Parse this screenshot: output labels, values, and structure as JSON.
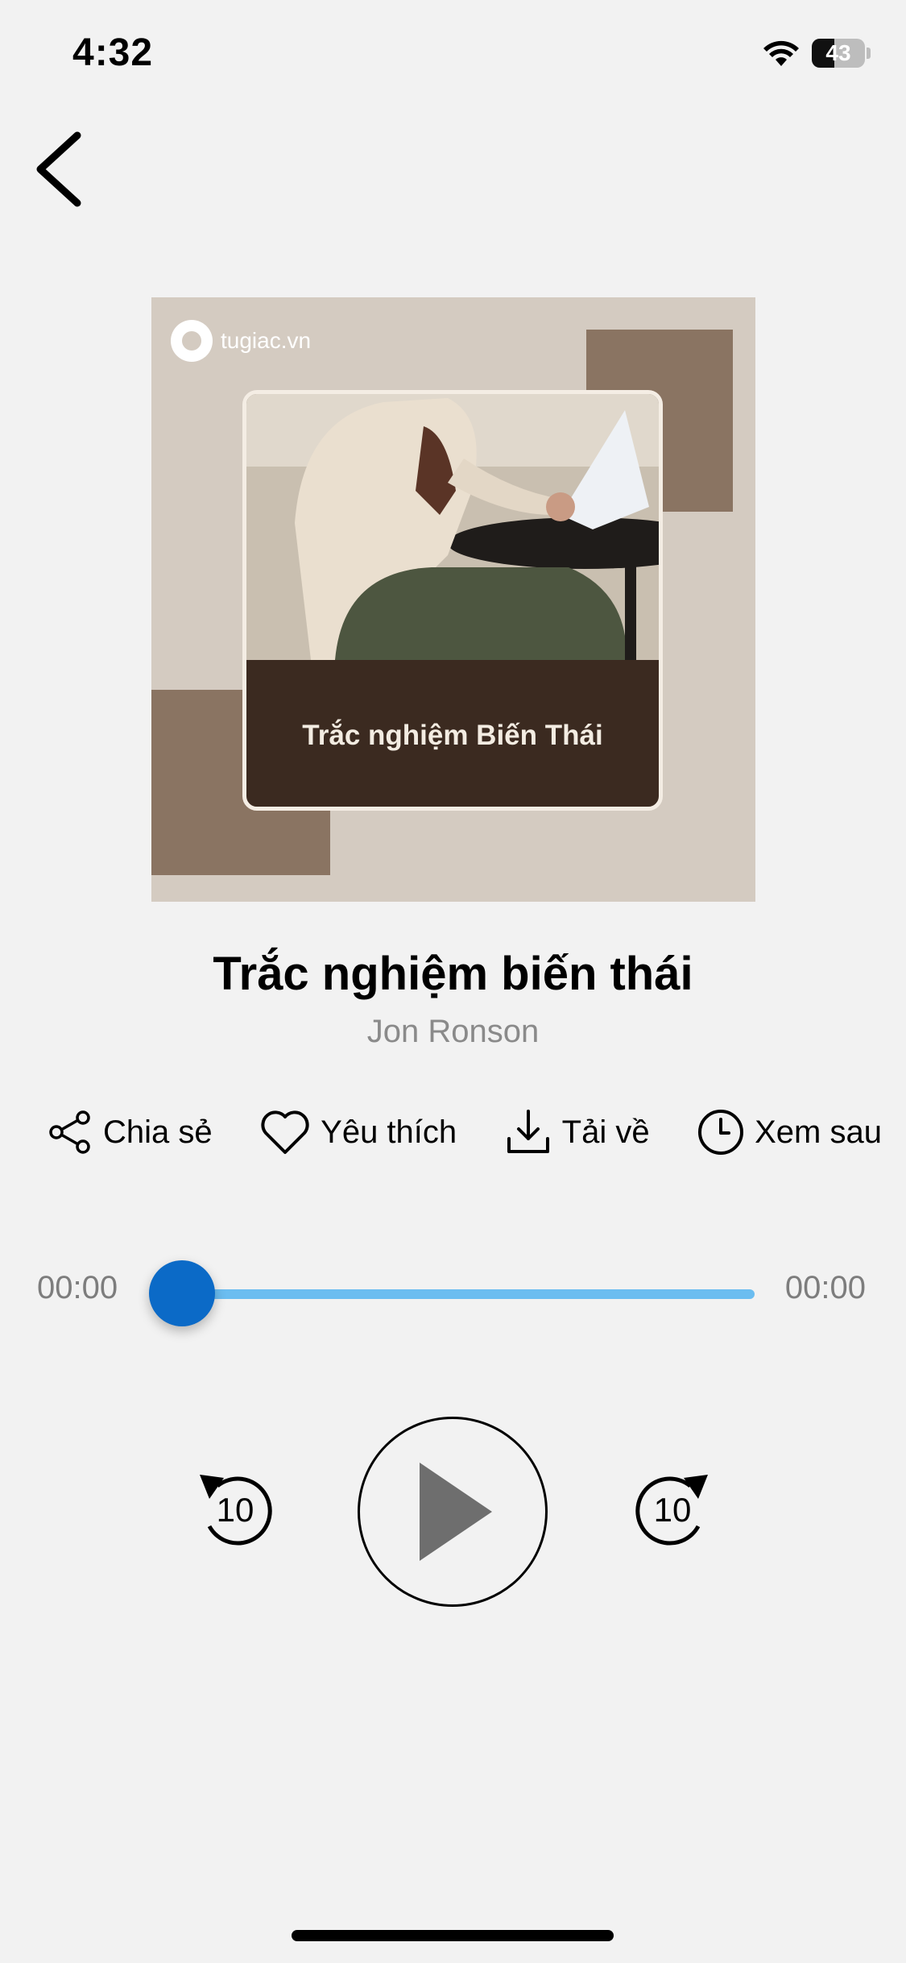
{
  "status_bar": {
    "time": "4:32",
    "battery_percent": "43",
    "icons": [
      "wifi-icon",
      "battery-icon"
    ]
  },
  "nav": {
    "back_icon": "chevron-left-icon"
  },
  "cover": {
    "logo_text": "tugiac.vn",
    "caption": "Trắc nghiệm Biến Thái",
    "colors": {
      "background": "#d4cbc1",
      "accent_squares": "#8a7462",
      "caption_panel": "#3b2a20"
    }
  },
  "track": {
    "title": "Trắc nghiệm biến thái",
    "author": "Jon Ronson"
  },
  "actions": [
    {
      "label": "Chia sẻ",
      "icon": "share-icon"
    },
    {
      "label": "Yêu thích",
      "icon": "heart-icon"
    },
    {
      "label": "Tải về",
      "icon": "download-icon"
    },
    {
      "label": "Xem sau",
      "icon": "clock-icon"
    }
  ],
  "player": {
    "elapsed": "00:00",
    "duration": "00:00",
    "progress": 0,
    "rewind_seconds": "10",
    "forward_seconds": "10",
    "colors": {
      "thumb": "#0b6ac7",
      "track": "#6bbdf0",
      "play_triangle": "#6e6e6e"
    }
  }
}
